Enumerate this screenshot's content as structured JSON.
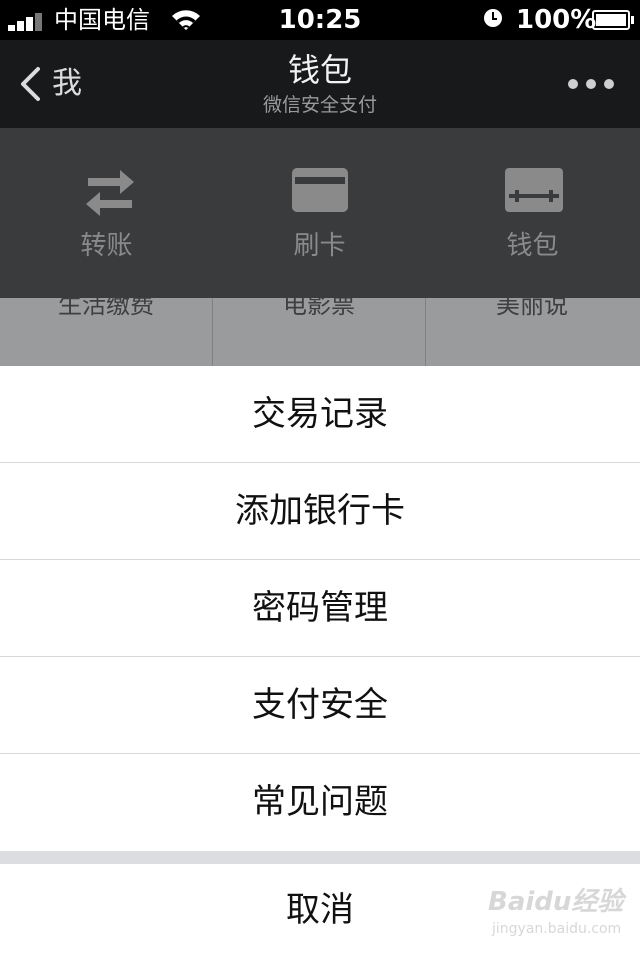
{
  "status_bar": {
    "carrier": "中国电信",
    "time": "10:25",
    "battery": "100%"
  },
  "nav": {
    "back_label": "我",
    "title": "钱包",
    "subtitle": "微信安全支付"
  },
  "wallet_actions": [
    {
      "label": "转账",
      "icon": "transfer-icon"
    },
    {
      "label": "刷卡",
      "icon": "card-icon"
    },
    {
      "label": "钱包",
      "icon": "wallet-icon"
    }
  ],
  "services": [
    {
      "label": "生活缴费"
    },
    {
      "label": "电影票"
    },
    {
      "label": "美丽说"
    }
  ],
  "action_sheet": {
    "items": [
      {
        "label": "交易记录"
      },
      {
        "label": "添加银行卡"
      },
      {
        "label": "密码管理"
      },
      {
        "label": "支付安全"
      },
      {
        "label": "常见问题"
      }
    ],
    "cancel_label": "取消"
  },
  "watermark": {
    "brand": "Baidu经验",
    "url": "jingyan.baidu.com"
  },
  "colors": {
    "nav_bg": "#18191b",
    "header_bg": "#3a3b3d",
    "sheet_bg": "#ffffff",
    "sheet_separator": "#dcdde1"
  }
}
